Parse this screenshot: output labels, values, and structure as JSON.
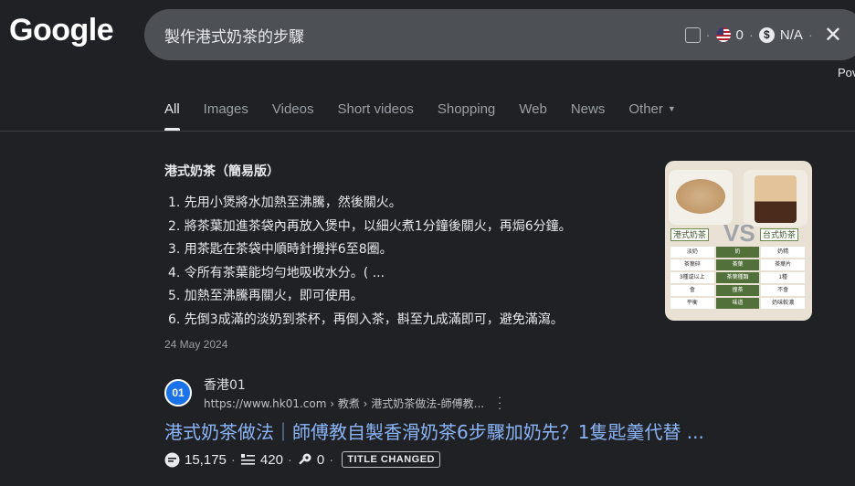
{
  "header": {
    "logo": "Google",
    "search_query": "製作港式奶茶的步驟",
    "ext_bar": {
      "flag_count": "0",
      "price": "N/A",
      "sep": "·"
    },
    "pov_label": "Pov"
  },
  "tabs": [
    {
      "label": "All",
      "active": true
    },
    {
      "label": "Images"
    },
    {
      "label": "Videos"
    },
    {
      "label": "Short videos"
    },
    {
      "label": "Shopping"
    },
    {
      "label": "Web"
    },
    {
      "label": "News"
    },
    {
      "label": "Other"
    }
  ],
  "snippet": {
    "title": "港式奶茶（簡易版）",
    "steps": [
      "1. 先用小煲將水加熱至沸騰，然後關火。",
      "2. 將茶葉加進茶袋內再放入煲中，以細火煮1分鐘後關火，再焗6分鐘。",
      "3. 用茶匙在茶袋中順時針攪拌6至8圈。",
      "4. 令所有茶葉能均勻地吸收水分。( ...",
      "5. 加熱至沸騰再關火，即可使用。",
      "6. 先倒3成滿的淡奶到茶杯，再倒入茶，斟至九成滿即可，避免滿瀉。"
    ],
    "date": "24 May 2024",
    "thumbnail": {
      "label_left": "港式奶茶",
      "label_right": "台式奶茶",
      "vs": "VS",
      "rows": [
        [
          "淡奶",
          "奶",
          "奶精"
        ],
        [
          "茶葉碎",
          "茶葉",
          "茶葉片"
        ],
        [
          "3種或以上",
          "茶葉種類",
          "1種"
        ],
        [
          "會",
          "撞茶",
          "不會"
        ],
        [
          "平衡",
          "味道",
          "奶味較濃"
        ]
      ]
    }
  },
  "result": {
    "favicon_text": "01",
    "site_name": "香港01",
    "url": "https://www.hk01.com › 教煮 › 港式奶茶做法-師傅教...",
    "title": "港式奶茶做法｜師傅教自製香滑奶茶6步驟加奶先？1隻匙羹代替 ...",
    "metrics": {
      "views": "15,175",
      "words": "420",
      "keys": "0",
      "badge": "TITLE CHANGED"
    }
  }
}
